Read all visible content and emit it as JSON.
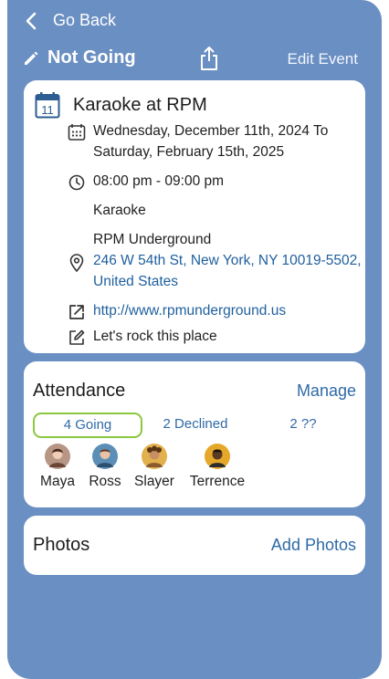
{
  "nav": {
    "back_label": "Go Back"
  },
  "actions": {
    "status_label": "Not Going",
    "edit_label": "Edit Event"
  },
  "event": {
    "calendar_day": "11",
    "title": "Karaoke at RPM",
    "date_line1": "Wednesday, December 11th, 2024 To",
    "date_line2": "Saturday, February 15th, 2025",
    "time": "08:00 pm - 09:00 pm",
    "category": "Karaoke",
    "venue": "RPM Underground",
    "address_line1": "246 W 54th St, New York, NY 10019-5502,",
    "address_line2": "United States",
    "website": "http://www.rpmunderground.us",
    "note": "Let's rock this place"
  },
  "attendance": {
    "title": "Attendance",
    "manage_label": "Manage",
    "tabs": [
      {
        "label": "4 Going",
        "active": true
      },
      {
        "label": "2 Declined",
        "active": false
      },
      {
        "label": "2 ??",
        "active": false
      }
    ],
    "people": [
      {
        "name": "Maya",
        "color": "#a07c6c"
      },
      {
        "name": "Ross",
        "color": "#4a7fa8"
      },
      {
        "name": "Slayer",
        "color": "#d9a340"
      },
      {
        "name": "Terrence",
        "color": "#e0a426"
      }
    ]
  },
  "photos": {
    "title": "Photos",
    "add_label": "Add Photos"
  },
  "colors": {
    "background": "#6a8fc2",
    "link": "#2e6aa6",
    "going_border": "#8dc63f"
  }
}
